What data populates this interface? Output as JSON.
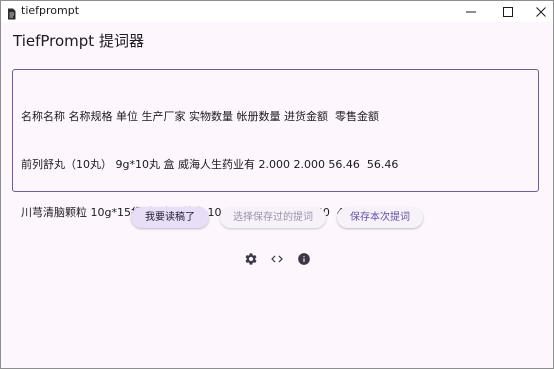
{
  "window": {
    "title": "tiefprompt",
    "icon": "app-document-icon",
    "controls": [
      "minimize-icon",
      "maximize-icon",
      "close-icon"
    ]
  },
  "app": {
    "title": "TiefPrompt 提词器"
  },
  "prompt": {
    "lines": [
      "名称名称 名称规格 单位 生产厂家 实物数量 帐册数量 进货金额  零售金额",
      "前列舒丸（10丸） 9g*10丸 盒 威海人生药业有 2.000 2.000 56.46  56.46",
      "川芎清脑颗粒 10g*15袋 盒 济川药业 10.000 10.000 499.50  499.50"
    ]
  },
  "buttons": {
    "read_done": "我要读稿了",
    "select_saved": "选择保存过的提词",
    "save_current": "保存本次提词"
  },
  "toolbar": {
    "icons": [
      "settings-icon",
      "code-icon",
      "info-icon"
    ]
  },
  "colors": {
    "background": "#fdf6fd",
    "accent": "#6750a4",
    "outline": "#6e5d97",
    "primary_button": "#e8def8"
  }
}
